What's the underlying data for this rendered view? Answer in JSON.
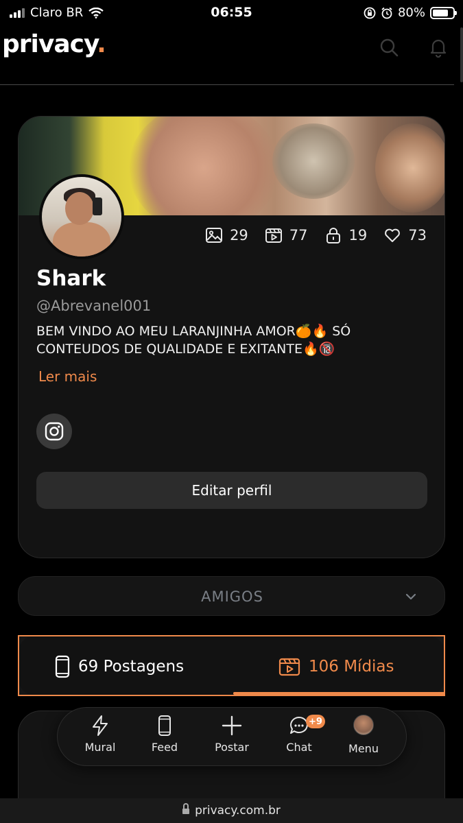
{
  "status": {
    "carrier": "Claro BR",
    "time": "06:55",
    "battery": "80%",
    "battery_level": 0.8
  },
  "header": {
    "logo": "privacy",
    "logo_dot": "."
  },
  "profile": {
    "stats": [
      {
        "icon": "image-icon",
        "value": "29"
      },
      {
        "icon": "video-icon",
        "value": "77"
      },
      {
        "icon": "lock-icon",
        "value": "19"
      },
      {
        "icon": "heart-icon",
        "value": "73"
      }
    ],
    "name": "Shark",
    "handle": "@Abrevanel001",
    "bio": "BEM VINDO AO MEU LARANJINHA AMOR🍊🔥 SÓ CONTEUDOS DE QUALIDADE E EXITANTE🔥🔞",
    "read_more": "Ler mais",
    "edit_button": "Editar perfil"
  },
  "friends": {
    "label": "AMIGOS"
  },
  "tabs": {
    "posts": "69 Postagens",
    "media": "106 Mídias"
  },
  "nav": {
    "mural": "Mural",
    "feed": "Feed",
    "post": "Postar",
    "chat": "Chat",
    "chat_badge": "+9",
    "menu": "Menu"
  },
  "browser": {
    "url": "privacy.com.br"
  },
  "colors": {
    "accent": "#f08a4b",
    "background": "#000000",
    "card": "#131313"
  }
}
